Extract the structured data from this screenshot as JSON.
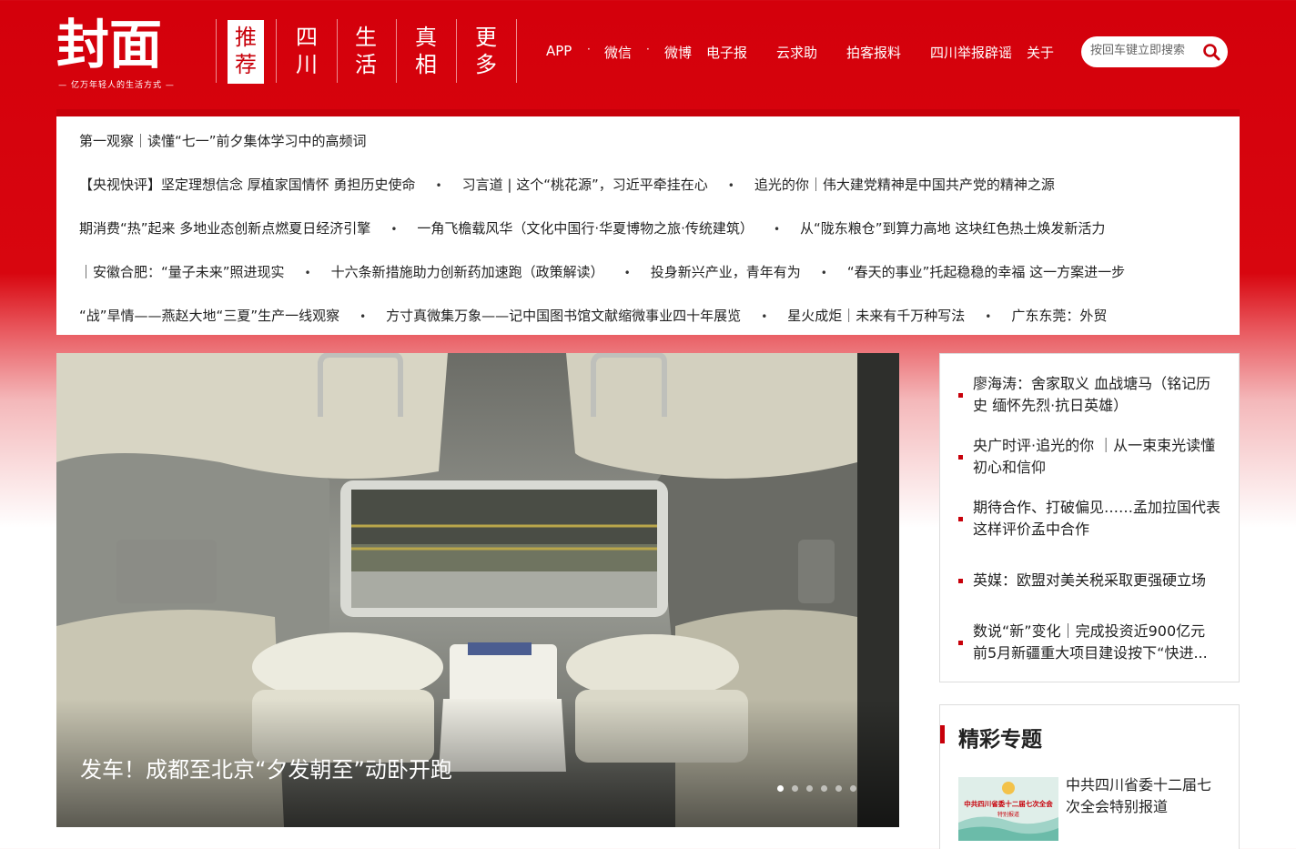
{
  "logo": {
    "name": "封面",
    "slogan": "— 亿万年轻人的生活方式 —"
  },
  "nav_tabs": [
    {
      "label_top": "推",
      "label_bottom": "荐",
      "active": true
    },
    {
      "label_top": "四",
      "label_bottom": "川",
      "active": false
    },
    {
      "label_top": "生",
      "label_bottom": "活",
      "active": false
    },
    {
      "label_top": "真",
      "label_bottom": "相",
      "active": false
    },
    {
      "label_top": "更",
      "label_bottom": "多",
      "active": false
    }
  ],
  "top_links": [
    "APP",
    "微信",
    "微博",
    "电子报",
    "云求助",
    "拍客报料",
    "四川举报辟谣",
    "关于"
  ],
  "search": {
    "placeholder": "按回车键立即搜索",
    "icon": "search-icon"
  },
  "headlines": {
    "top": "第一观察｜读懂“七一”前夕集体学习中的高频词",
    "rows": [
      [
        "【央视快评】坚定理想信念 厚植家国情怀 勇担历史使命",
        "习言道 | 这个“桃花源”，习近平牵挂在心",
        "追光的你｜伟大建党精神是中国共产党的精神之源"
      ],
      [
        "期消费“热”起来 多地业态创新点燃夏日经济引擎",
        "一角飞檐载风华（文化中国行·华夏博物之旅·传统建筑）",
        "从“陇东粮仓”到算力高地 这块红色热土焕发新活力"
      ],
      [
        "｜安徽合肥：“量子未来”照进现实",
        "十六条新措施助力创新药加速跑（政策解读）",
        "投身新兴产业，青年有为",
        "“春天的事业”托起稳稳的幸福 这一方案进一步"
      ],
      [
        "“战”旱情——燕赵大地“三夏”生产一线观察",
        "方寸真微集万象——记中国图书馆文献缩微事业四十年展览",
        "星火成炬｜未来有千万种写法",
        "广东东莞：外贸"
      ]
    ]
  },
  "slide": {
    "caption": "发车！成都至北京“夕发朝至”动卧开跑",
    "dot_count": 6,
    "active_dot": 0
  },
  "side_news": [
    "廖海涛：舍家取义 血战塘马（铭记历史 缅怀先烈·抗日英雄）",
    "央广时评·追光的你 ｜从一束束光读懂初心和信仰",
    "期待合作、打破偏见……孟加拉国代表这样评价孟中合作",
    "英媒：欧盟对美关税采取更强硬立场",
    "数说“新”变化｜完成投资近900亿元 前5月新疆重大项目建设按下“快进..."
  ],
  "topics": {
    "title": "精彩专题",
    "item": {
      "text": "中共四川省委十二届七次全会特别报道",
      "thumb_text": "中共四川省委十二届七次全会",
      "thumb_sub": "特别报道"
    }
  },
  "colors": {
    "brand_red": "#c8000a",
    "header_red": "#d4000b"
  }
}
